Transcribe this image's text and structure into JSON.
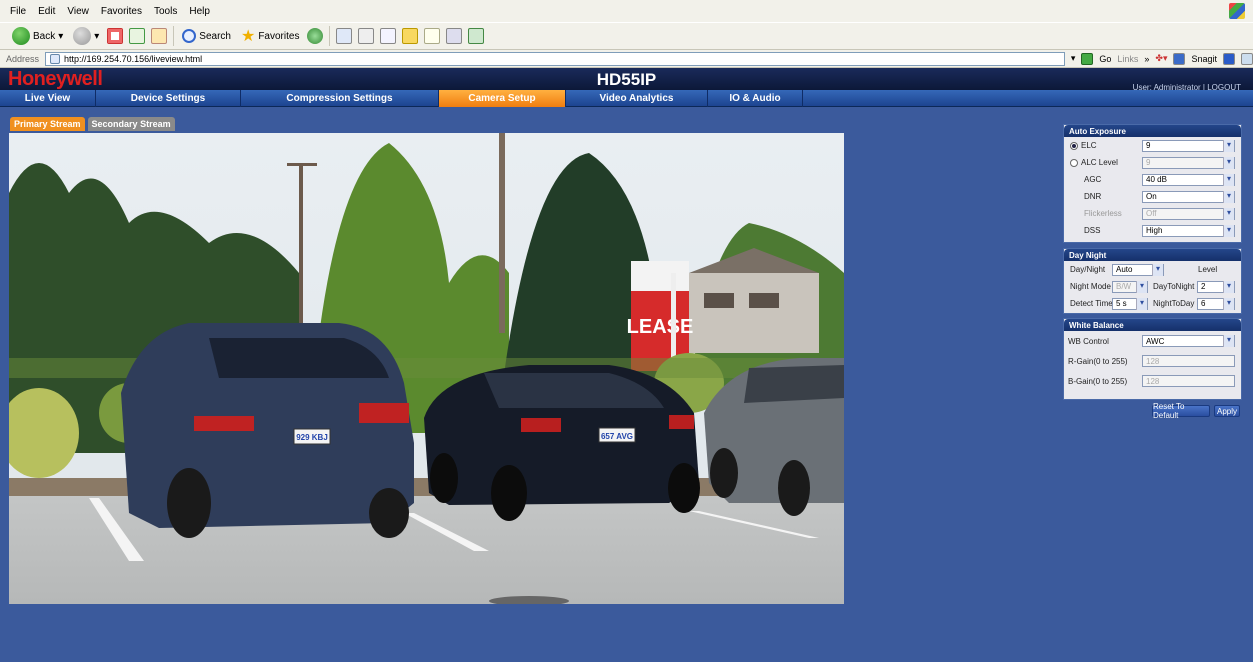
{
  "browser": {
    "menu": [
      "File",
      "Edit",
      "View",
      "Favorites",
      "Tools",
      "Help"
    ],
    "toolbar": {
      "back": "Back",
      "search": "Search",
      "favorites": "Favorites"
    },
    "address_label": "Address",
    "address_url": "http://169.254.70.156/liveview.html",
    "go": "Go",
    "links": "Links",
    "snagit": "Snagit"
  },
  "app": {
    "brand": "Honeywell",
    "model": "HD55IP",
    "user_info": "User: Administrator | LOGOUT"
  },
  "nav": {
    "tabs": [
      {
        "label": "Live View",
        "active": false
      },
      {
        "label": "Device Settings",
        "active": false
      },
      {
        "label": "Compression Settings",
        "active": false
      },
      {
        "label": "Camera Setup",
        "active": true
      },
      {
        "label": "Video Analytics",
        "active": false
      },
      {
        "label": "IO & Audio",
        "active": false
      }
    ]
  },
  "streams": {
    "primary": "Primary Stream",
    "secondary": "Secondary Stream"
  },
  "video": {
    "plates": [
      "929 KBJ",
      "657 AVG"
    ],
    "sign": "LEASE"
  },
  "auto_exposure": {
    "title": "Auto Exposure",
    "elc_label": "ELC",
    "elc_value": "9",
    "alc_label": "ALC Level",
    "alc_value": "9",
    "agc_label": "AGC",
    "agc_value": "40 dB",
    "dnr_label": "DNR",
    "dnr_value": "On",
    "flickerless_label": "Flickerless",
    "flickerless_value": "Off",
    "dss_label": "DSS",
    "dss_value": "High"
  },
  "day_night": {
    "title": "Day Night",
    "daynight_label": "Day/Night",
    "daynight_value": "Auto",
    "level_label": "Level",
    "night_mode_label": "Night Mode",
    "night_mode_value": "B/W",
    "day_to_night_label": "DayToNight",
    "day_to_night_value": "2",
    "detect_time_label": "Detect Time",
    "detect_time_value": "5 s",
    "night_to_day_label": "NightToDay",
    "night_to_day_value": "6"
  },
  "white_balance": {
    "title": "White Balance",
    "wb_control_label": "WB Control",
    "wb_control_value": "AWC",
    "r_gain_label": "R-Gain(0 to 255)",
    "r_gain_value": "128",
    "b_gain_label": "B-Gain(0 to 255)",
    "b_gain_value": "128"
  },
  "actions": {
    "reset": "Reset To Default",
    "apply": "Apply"
  }
}
